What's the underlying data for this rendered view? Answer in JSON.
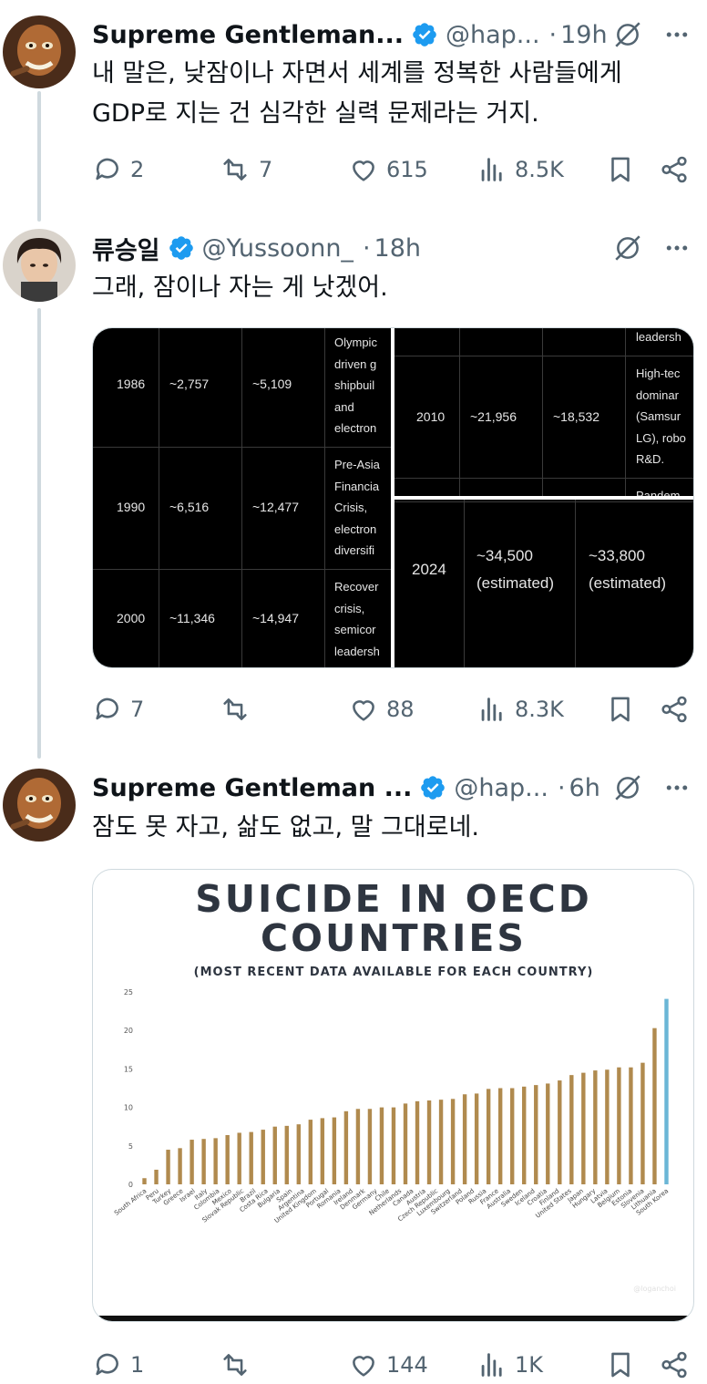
{
  "tweets": [
    {
      "name": "Supreme Gentleman...",
      "handle": "@hap...",
      "time": "19h",
      "text_lines": [
        "내 말은, 낮잠이나 자면서 세계를 정복한 사람들에게",
        "GDP로 지는 건 심각한 실력 문제라는 거지."
      ],
      "replies": "2",
      "reposts": "7",
      "likes": "615",
      "views": "8.5K"
    },
    {
      "name": "류승일",
      "handle": "@Yussoonn_",
      "time": "18h",
      "text_lines": [
        "그래, 잠이나 자는 게 낫겠어."
      ],
      "replies": "7",
      "reposts": "",
      "likes": "88",
      "views": "8.3K"
    },
    {
      "name": "Supreme Gentleman ...",
      "handle": "@hap...",
      "time": "6h",
      "text_lines": [
        "잠도 못 자고, 삶도 없고, 말 그대로네."
      ],
      "replies": "1",
      "reposts": "",
      "likes": "144",
      "views": "1K"
    }
  ],
  "separator_dot": "·",
  "gdp_table_left": {
    "rows": [
      {
        "year": "1986",
        "kr": "~2,757",
        "tw": "~5,109",
        "note": [
          "Olympic",
          "driven g",
          "shipbuil",
          "and",
          "electron"
        ]
      },
      {
        "year": "1990",
        "kr": "~6,516",
        "tw": "~12,477",
        "note": [
          "Pre-Asia",
          "Financia",
          "Crisis,",
          "electron",
          "diversifi"
        ]
      },
      {
        "year": "2000",
        "kr": "~11,346",
        "tw": "~14,947",
        "note": [
          "Recover",
          "crisis,",
          "semicor",
          "leadersh"
        ]
      }
    ]
  },
  "gdp_table_right_top": {
    "top_note": "leadersh",
    "row": {
      "year": "2010",
      "kr": "~21,956",
      "tw": "~18,532",
      "note": [
        "High-tec",
        "dominar",
        "(Samsur",
        "LG), robo",
        "R&D."
      ]
    },
    "bottom_note": "Pandem"
  },
  "gdp_table_right_bottom": {
    "year": "2024",
    "kr_line1": "~34,500",
    "kr_line2": "(estimated)",
    "tw_line1": "~33,800",
    "tw_line2": "(estimated)"
  },
  "infographic": {
    "title_line1": "SUICIDE IN OECD",
    "title_line2": "COUNTRIES",
    "subtitle": "(MOST RECENT DATA AVAILABLE FOR EACH COUNTRY)",
    "watermark": "@loganchoi",
    "colors": {
      "bar": "#b08a4e",
      "highlight": "#6bb6d6",
      "title": "#2e3540"
    }
  },
  "chart_data": {
    "type": "bar",
    "title": "SUICIDE IN OECD COUNTRIES",
    "subtitle": "(MOST RECENT DATA AVAILABLE FOR EACH COUNTRY)",
    "ylim": [
      0,
      25
    ],
    "yticks": [
      0,
      5,
      10,
      15,
      20,
      25
    ],
    "grid": false,
    "categories": [
      "South Africa",
      "Peru",
      "Turkey",
      "Greece",
      "Israel",
      "Italy",
      "Colombia",
      "Mexico",
      "Slovak Republic",
      "Brazil",
      "Costa Rica",
      "Bulgaria",
      "Spain",
      "Argentina",
      "United Kingdom",
      "Portugal",
      "Romania",
      "Ireland",
      "Denmark",
      "Germany",
      "Chile",
      "Netherlands",
      "Canada",
      "Austria",
      "Czech Republic",
      "Luxembourg",
      "Switzerland",
      "Poland",
      "Russia",
      "France",
      "Australia",
      "Sweden",
      "Iceland",
      "Croatia",
      "Finland",
      "United States",
      "Japan",
      "Hungary",
      "Latvia",
      "Belgium",
      "Estonia",
      "Slovenia",
      "Lithuania",
      "South Korea"
    ],
    "values": [
      0.8,
      1.9,
      4.5,
      4.7,
      5.8,
      5.9,
      6.0,
      6.4,
      6.7,
      6.8,
      7.1,
      7.5,
      7.6,
      7.8,
      8.4,
      8.6,
      8.7,
      9.5,
      9.8,
      9.8,
      10.0,
      10.0,
      10.5,
      10.8,
      10.9,
      11.0,
      11.1,
      11.7,
      11.8,
      12.4,
      12.5,
      12.5,
      12.7,
      12.9,
      13.1,
      13.5,
      14.2,
      14.5,
      14.8,
      14.9,
      15.2,
      15.2,
      15.8,
      20.3,
      24.1
    ]
  }
}
